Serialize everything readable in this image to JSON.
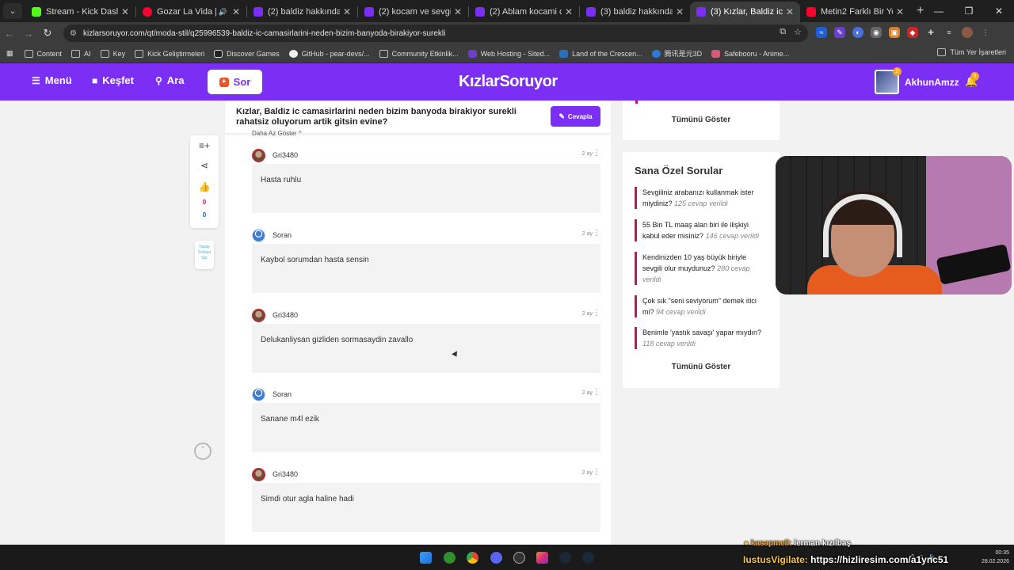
{
  "browser": {
    "tabs": [
      {
        "title": "Stream - Kick Dashboard",
        "color": "#53fc18"
      },
      {
        "title": "Gozar La Vida | YouTu",
        "color": "#ff0033"
      },
      {
        "title": "(2) baldiz hakkında Sorula",
        "color": "#7b2ff5"
      },
      {
        "title": "(2) kocam ve sevgilim hak",
        "color": "#7b2ff5"
      },
      {
        "title": "(2) Ablam kocami caldin o",
        "color": "#7b2ff5"
      },
      {
        "title": "(3) baldiz hakkında Sorula",
        "color": "#7b2ff5"
      },
      {
        "title": "(3) Kızlar, Baldiz ic camas",
        "color": "#7b2ff5"
      },
      {
        "title": "Metin2 Farklı Bir Yorum \"",
        "color": "#ff0033"
      }
    ],
    "url": "kizlarsoruyor.com/qt/moda-stil/q25996539-baldiz-ic-camasirlarini-neden-bizim-banyoda-birakiyor-surekli",
    "bookmarks": [
      "Content",
      "AI",
      "Key",
      "Kick Geliştirmeleri",
      "Discover Games",
      "GitHub - pear-devs/...",
      "Community Etkinlik...",
      "Web Hosting - Sited...",
      "Land of the Crescen...",
      "腾讯是元3D",
      "Safebooru - Anime..."
    ],
    "bookmarks_right": "Tüm Yer İşaretleri"
  },
  "site": {
    "nav": {
      "menu": "Menü",
      "explore": "Keşfet",
      "search": "Ara",
      "ask": "Sor"
    },
    "logo": "KızlarSoruyor",
    "username": "AkhunAmzz",
    "avatar_badge": "2",
    "bell_badge": "9"
  },
  "question": {
    "title": "Kızlar, Baldiz ic camasirlarini neden bizim banyoda birakiyor surekli rahatsiz oluyorum artik gitsin evine?",
    "answer_button": "Cevapla",
    "show_less": "Daha Az Göster ^"
  },
  "replies": [
    {
      "user": "Gri3480",
      "time": "2 ay",
      "text": "Hasta ruhlu",
      "avatar": "photo"
    },
    {
      "user": "Soran",
      "time": "2 ay",
      "text": "Kaybol sorumdan hasta sensin",
      "avatar": "anon"
    },
    {
      "user": "Gri3480",
      "time": "2 ay",
      "text": "Delukanliysan gizliden sormasaydin zavallo",
      "avatar": "photo"
    },
    {
      "user": "Soran",
      "time": "2 ay",
      "text": "Sanane m4l ezik",
      "avatar": "anon"
    },
    {
      "user": "Gri3480",
      "time": "2 ay",
      "text": "Simdi otur agla haline hadi",
      "avatar": "photo"
    }
  ],
  "sidetool": {
    "likes": "0",
    "dislikes": "0",
    "ai_label": "Yapay Zekaya Sor"
  },
  "sidebar": {
    "show_all_top": "Tümünü Göster",
    "special_title": "Sana Özel Sorular",
    "special_questions": [
      {
        "q": "Sevgiliniz arabanızı kullanmak ister miydiniz?",
        "count": "125 cevap verildi"
      },
      {
        "q": "55 Bin TL maaş alan biri ile ilişkiyi kabul eder misiniz?",
        "count": "146 cevap verildi"
      },
      {
        "q": "Kendinizden 10 yaş büyük biriyle sevgili olur muydunuz?",
        "count": "280 cevap verildi"
      },
      {
        "q": "Çok sık \"seni seviyorum\" demek itici mi?",
        "count": "94 cevap verildi"
      },
      {
        "q": "Benimle 'yastık savaşı' yapar mıydın?",
        "count": "118 cevap verildi"
      }
    ],
    "show_all_bottom": "Tümünü Göster"
  },
  "stream_chat": [
    {
      "user": "kasapmeli:",
      "message": "lerman kızılbaş"
    },
    {
      "user": "IustusVigilate:",
      "message": "https://hizliresim.com/a1ync51"
    }
  ],
  "taskbar": {
    "time": "00:35",
    "date": "28.02.2026"
  }
}
